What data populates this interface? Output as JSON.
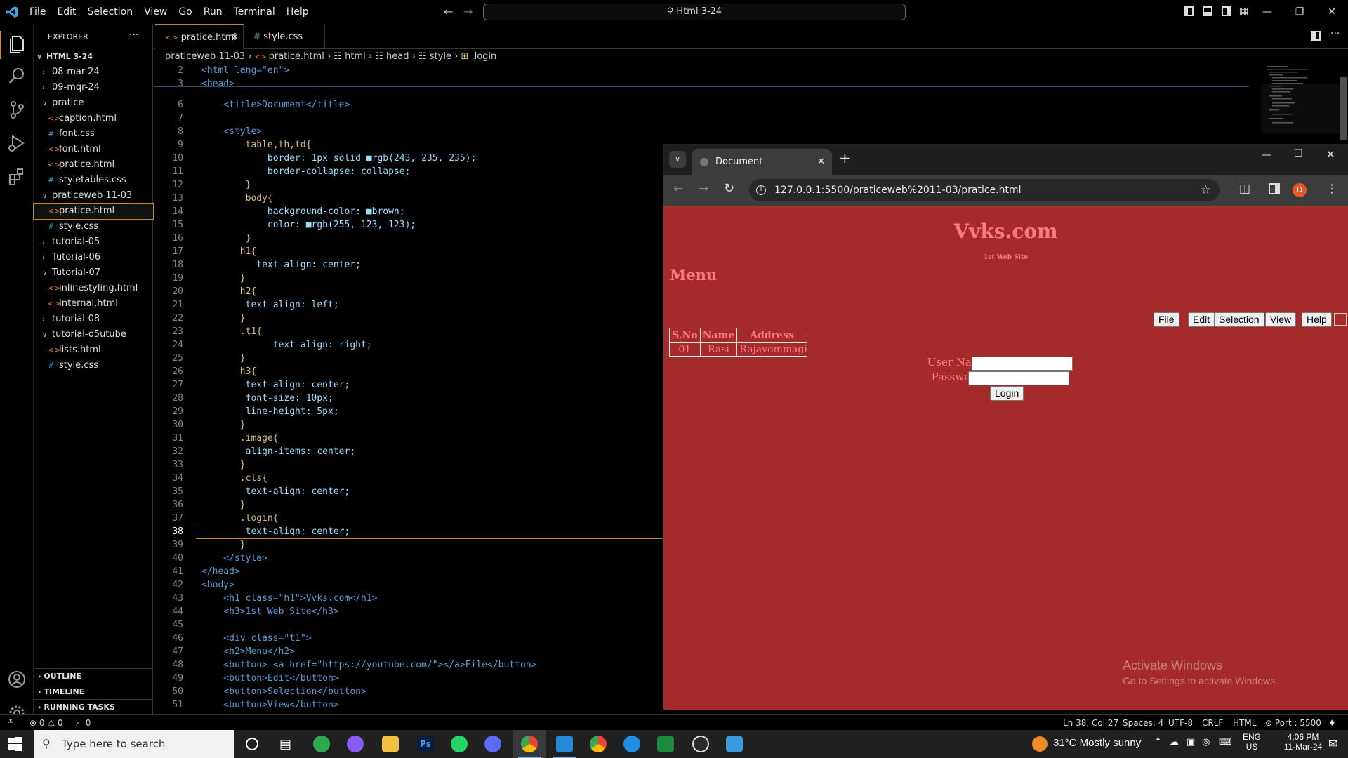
{
  "titlebar": {
    "menu": [
      "File",
      "Edit",
      "Selection",
      "View",
      "Go",
      "Run",
      "Terminal",
      "Help"
    ],
    "command_center": "Html 3-24"
  },
  "sidebar": {
    "header": "EXPLORER",
    "root": "HTML 3-24",
    "tree": [
      {
        "label": "08-mar-24",
        "type": "folder",
        "open": false,
        "depth": 1
      },
      {
        "label": "09-mqr-24",
        "type": "folder",
        "open": false,
        "depth": 1
      },
      {
        "label": "pratice",
        "type": "folder",
        "open": true,
        "depth": 1
      },
      {
        "label": "caption.html",
        "type": "html",
        "depth": 2
      },
      {
        "label": "font.css",
        "type": "css",
        "depth": 2
      },
      {
        "label": "font.html",
        "type": "html",
        "depth": 2
      },
      {
        "label": "pratice.html",
        "type": "html",
        "depth": 2
      },
      {
        "label": "styletables.css",
        "type": "css",
        "depth": 2
      },
      {
        "label": "praticeweb 11-03",
        "type": "folder",
        "open": true,
        "depth": 1
      },
      {
        "label": "pratice.html",
        "type": "html",
        "depth": 2,
        "selected": true
      },
      {
        "label": "style.css",
        "type": "css",
        "depth": 2
      },
      {
        "label": "tutorial-05",
        "type": "folder",
        "open": false,
        "depth": 1
      },
      {
        "label": "Tutorial-06",
        "type": "folder",
        "open": false,
        "depth": 1
      },
      {
        "label": "Tutorial-07",
        "type": "folder",
        "open": true,
        "depth": 1
      },
      {
        "label": "inlinestyling.html",
        "type": "html",
        "depth": 2
      },
      {
        "label": "Internal.html",
        "type": "html",
        "depth": 2
      },
      {
        "label": "tutorial-08",
        "type": "folder",
        "open": false,
        "depth": 1
      },
      {
        "label": "tutorial-o5utube",
        "type": "folder",
        "open": true,
        "depth": 1
      },
      {
        "label": "lists.html",
        "type": "html",
        "depth": 2
      },
      {
        "label": "style.css",
        "type": "css",
        "depth": 2
      }
    ],
    "sections": [
      "OUTLINE",
      "TIMELINE",
      "RUNNING TASKS"
    ]
  },
  "tabs": [
    {
      "label": "pratice.html",
      "icon": "<>",
      "active": true
    },
    {
      "label": "style.css",
      "icon": "#",
      "active": false
    }
  ],
  "breadcrumb": [
    "praticeweb 11-03",
    "pratice.html",
    "html",
    "head",
    "style",
    ".login"
  ],
  "editor": {
    "lines": [
      {
        "n": "2",
        "t": "<html lang=\"en\">"
      },
      {
        "n": "3",
        "t": "<head>"
      },
      {
        "n": "6",
        "t": "    <title>Document</title>"
      },
      {
        "n": "7",
        "t": ""
      },
      {
        "n": "8",
        "t": "    <style>"
      },
      {
        "n": "9",
        "t": "        table,th,td{"
      },
      {
        "n": "10",
        "t": "            border: 1px solid ■rgb(243, 235, 235);"
      },
      {
        "n": "11",
        "t": "            border-collapse: collapse;"
      },
      {
        "n": "12",
        "t": "        }"
      },
      {
        "n": "13",
        "t": "        body{"
      },
      {
        "n": "14",
        "t": "            background-color: ■brown;"
      },
      {
        "n": "15",
        "t": "            color: ■rgb(255, 123, 123);"
      },
      {
        "n": "16",
        "t": "        }"
      },
      {
        "n": "17",
        "t": "       h1{"
      },
      {
        "n": "18",
        "t": "          text-align: center;"
      },
      {
        "n": "19",
        "t": "       }"
      },
      {
        "n": "20",
        "t": "       h2{"
      },
      {
        "n": "21",
        "t": "        text-align: left;"
      },
      {
        "n": "22",
        "t": "       }"
      },
      {
        "n": "23",
        "t": "       .t1{"
      },
      {
        "n": "24",
        "t": "             text-align: right;"
      },
      {
        "n": "25",
        "t": "       }"
      },
      {
        "n": "26",
        "t": "       h3{"
      },
      {
        "n": "27",
        "t": "        text-align: center;"
      },
      {
        "n": "28",
        "t": "        font-size: 10px;"
      },
      {
        "n": "29",
        "t": "        line-height: 5px;"
      },
      {
        "n": "30",
        "t": "       }"
      },
      {
        "n": "31",
        "t": "       .image{"
      },
      {
        "n": "32",
        "t": "        align-items: center;"
      },
      {
        "n": "33",
        "t": "       }"
      },
      {
        "n": "34",
        "t": "       .cls{"
      },
      {
        "n": "35",
        "t": "        text-align: center;"
      },
      {
        "n": "36",
        "t": "       }"
      },
      {
        "n": "37",
        "t": "       .login{"
      },
      {
        "n": "38",
        "t": "        text-align: center;"
      },
      {
        "n": "39",
        "t": "       }"
      },
      {
        "n": "40",
        "t": "    </style>"
      },
      {
        "n": "41",
        "t": "</head>"
      },
      {
        "n": "42",
        "t": "<body>"
      },
      {
        "n": "43",
        "t": "    <h1 class=\"h1\">Vvks.com</h1>"
      },
      {
        "n": "44",
        "t": "    <h3>1st Web Site</h3>"
      },
      {
        "n": "45",
        "t": ""
      },
      {
        "n": "46",
        "t": "    <div class=\"t1\">"
      },
      {
        "n": "47",
        "t": "    <h2>Menu</h2>"
      },
      {
        "n": "48",
        "t": "    <button> <a href=\"https://youtube.com/\"></a>File</button>"
      },
      {
        "n": "49",
        "t": "    <button>Edit</button>"
      },
      {
        "n": "50",
        "t": "    <button>Selection</button>"
      },
      {
        "n": "51",
        "t": "    <button>View</button>"
      }
    ]
  },
  "browser": {
    "tab_title": "Document",
    "url": "127.0.0.1:5500/praticeweb%2011-03/pratice.html",
    "profile": "D",
    "page": {
      "h1": "Vvks.com",
      "h3": "1st Web Site",
      "h2": "Menu",
      "buttons": [
        "File",
        "Edit",
        "Selection",
        "View",
        "Help"
      ],
      "table": {
        "headers": [
          "S.No",
          "Name",
          "Address"
        ],
        "rows": [
          [
            "01",
            "Rasi",
            "Rajavommagi"
          ]
        ]
      },
      "username_label": "User Name",
      "password_label": "Password",
      "login_button": "Login"
    },
    "watermark_title": "Activate Windows",
    "watermark_sub": "Go to Settings to activate Windows."
  },
  "statusbar": {
    "errors": "0",
    "warnings": "0",
    "ports": "0",
    "position": "Ln 38, Col 27",
    "spaces": "Spaces: 4",
    "encoding": "UTF-8",
    "eol": "CRLF",
    "language": "HTML",
    "port": "Port : 5500"
  },
  "taskbar": {
    "search_placeholder": "Type here to search",
    "weather": "31°C  Mostly sunny",
    "lang": "ENG",
    "region": "US",
    "time": "4:06 PM",
    "date": "11-Mar-24"
  }
}
